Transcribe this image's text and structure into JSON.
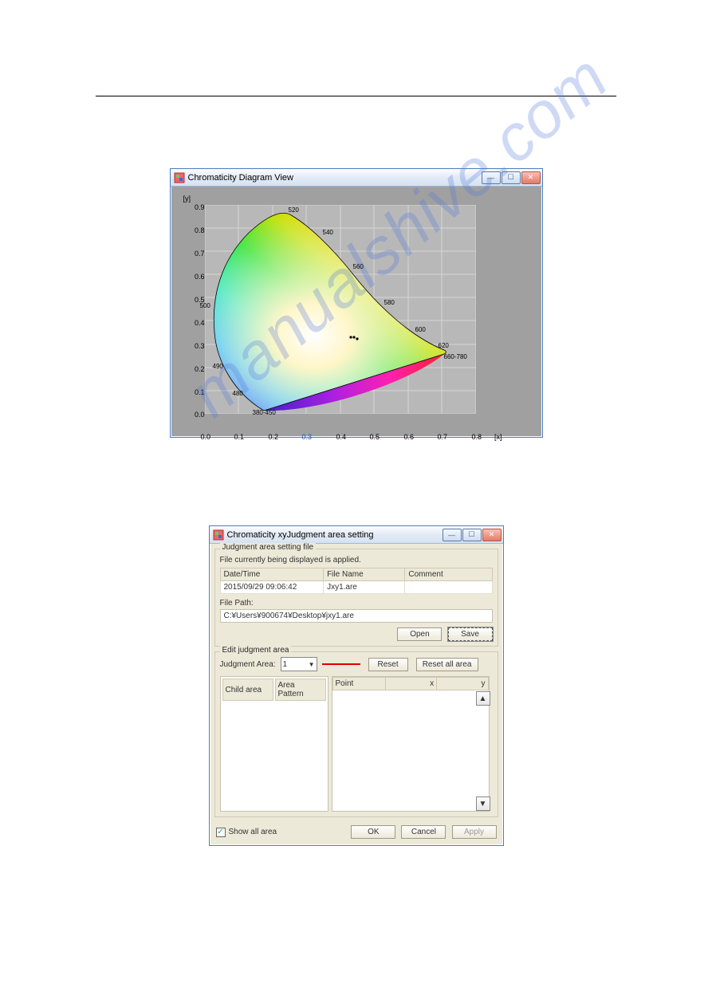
{
  "watermark": "manualshive.com",
  "window1": {
    "title": "Chromaticity Diagram View",
    "min_tip": "Minimize",
    "max_tip": "Maximize",
    "close_tip": "Close",
    "ylabel": "[y]",
    "xlabel": "[x]",
    "yticks": [
      "0.9",
      "0.8",
      "0.7",
      "0.6",
      "0.5",
      "0.4",
      "0.3",
      "0.2",
      "0.1",
      "0.0"
    ],
    "xticks": [
      "0.0",
      "0.1",
      "0.2",
      "0.3",
      "0.4",
      "0.5",
      "0.6",
      "0.7",
      "0.8"
    ],
    "wavelengths": [
      "520",
      "540",
      "560",
      "580",
      "600",
      "620",
      "660-780",
      "500",
      "490",
      "480",
      "380-450"
    ]
  },
  "window2": {
    "title": "Chromaticity xyJudgment area setting",
    "min_tip": "Minimize",
    "max_tip": "Maximize",
    "close_tip": "Close",
    "group1": {
      "legend": "Judgment area setting file",
      "hint": "File currently being displayed is applied.",
      "cols": {
        "dt": "Date/Time",
        "fn": "File Name",
        "cm": "Comment"
      },
      "row": {
        "dt": "2015/09/29 09:06:42",
        "fn": "Jxy1.are",
        "cm": ""
      },
      "path_label": "File Path:",
      "path_value": "C:¥Users¥900674¥Desktop¥jxy1.are",
      "open": "Open",
      "save": "Save"
    },
    "group2": {
      "legend": "Edit judgment area",
      "judg_label": "Judgment Area:",
      "judg_value": "1",
      "reset": "Reset",
      "reset_all": "Reset all area",
      "cols2": {
        "ca": "Child area",
        "ap": "Area Pattern"
      },
      "cols3": {
        "pt": "Point",
        "x": "x",
        "y": "y"
      },
      "up_tip": "Move up",
      "down_tip": "Move down"
    },
    "show_all": "Show all area",
    "ok": "OK",
    "cancel": "Cancel",
    "apply": "Apply"
  },
  "chart_data": {
    "type": "scatter",
    "title": "CIE 1931 xy Chromaticity Diagram",
    "xlabel": "[x]",
    "ylabel": "[y]",
    "xlim": [
      0.0,
      0.8
    ],
    "ylim": [
      0.0,
      0.9
    ],
    "spectral_locus_labels_nm": [
      380,
      450,
      480,
      490,
      500,
      520,
      540,
      560,
      580,
      600,
      620,
      660,
      780
    ],
    "plotted_points_xy": [
      [
        0.43,
        0.33
      ],
      [
        0.44,
        0.33
      ],
      [
        0.45,
        0.325
      ]
    ]
  }
}
